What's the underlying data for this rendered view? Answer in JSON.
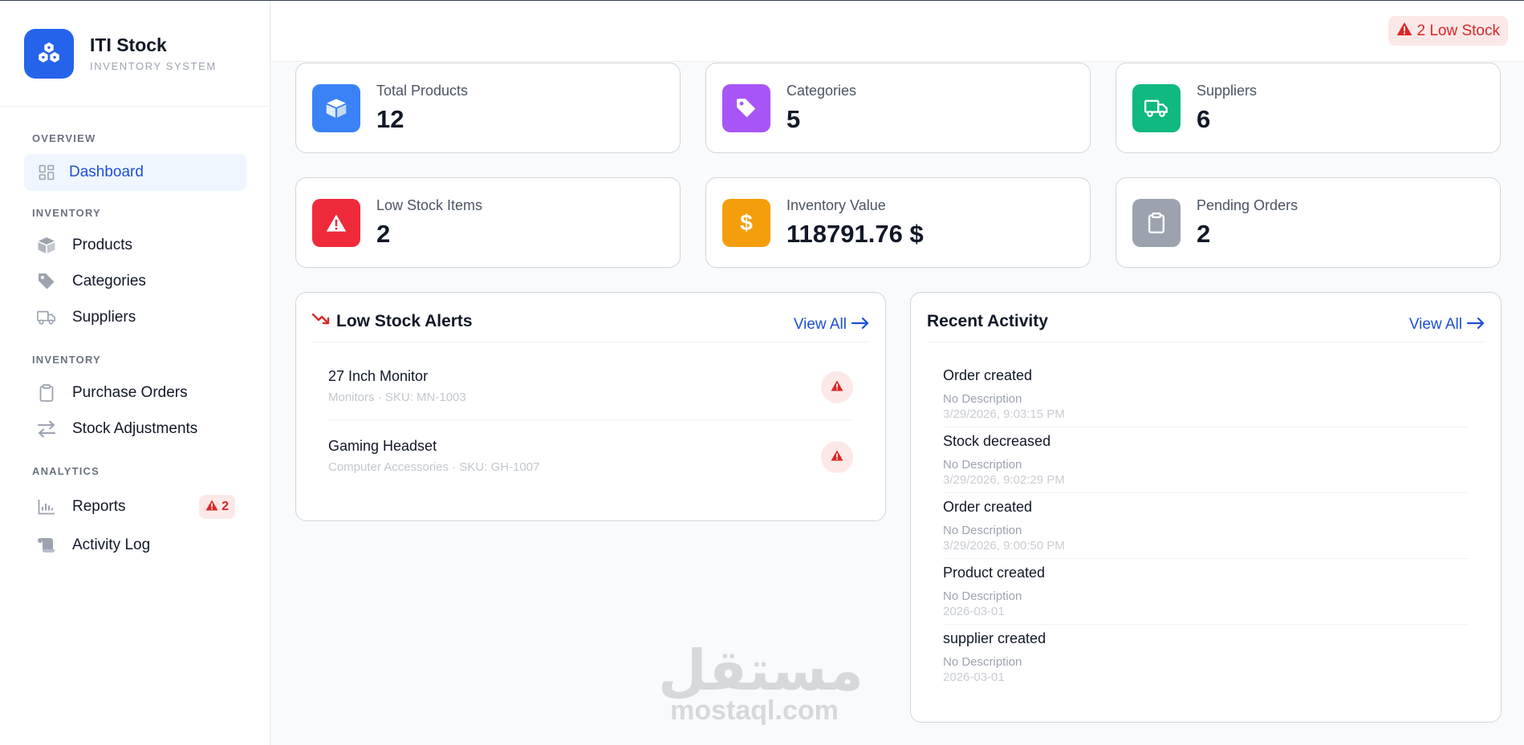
{
  "brand": {
    "title": "ITI Stock",
    "subtitle": "INVENTORY SYSTEM"
  },
  "sidebar": {
    "sections": [
      {
        "label": "OVERVIEW"
      },
      {
        "label": "INVENTORY"
      },
      {
        "label": "INVENTORY"
      },
      {
        "label": "ANALYTICS"
      }
    ],
    "items": [
      {
        "label": "Dashboard",
        "icon": "dashboard-grid-icon",
        "active": true
      },
      {
        "label": "Products",
        "icon": "box-icon"
      },
      {
        "label": "Categories",
        "icon": "tag-icon"
      },
      {
        "label": "Suppliers",
        "icon": "truck-icon"
      },
      {
        "label": "Purchase Orders",
        "icon": "clipboard-icon"
      },
      {
        "label": "Stock Adjustments",
        "icon": "arrows-exchange-icon"
      },
      {
        "label": "Reports",
        "icon": "chart-bars-icon",
        "badge": "2"
      },
      {
        "label": "Activity Log",
        "icon": "scroll-icon"
      }
    ]
  },
  "header": {
    "low_stock_badge": "2 Low Stock"
  },
  "stats": [
    {
      "label": "Total Products",
      "value": "12",
      "color": "#3b82f6",
      "icon": "box-icon"
    },
    {
      "label": "Categories",
      "value": "5",
      "color": "#a855f7",
      "icon": "tag-icon"
    },
    {
      "label": "Suppliers",
      "value": "6",
      "color": "#10b981",
      "icon": "truck-icon"
    },
    {
      "label": "Low Stock Items",
      "value": "2",
      "color": "#ef2b3b",
      "icon": "warning-icon"
    },
    {
      "label": "Inventory Value",
      "value": "118791.76 $",
      "color": "#f59e0b",
      "icon": "dollar-icon"
    },
    {
      "label": "Pending Orders",
      "value": "2",
      "color": "#9ca3af",
      "icon": "clipboard-icon"
    }
  ],
  "low_stock": {
    "title": "Low Stock Alerts",
    "view_all": "View All",
    "items": [
      {
        "name": "27 Inch Monitor",
        "meta": "Monitors · SKU: MN-1003"
      },
      {
        "name": "Gaming Headset",
        "meta": "Computer Accessories · SKU: GH-1007"
      }
    ]
  },
  "activity": {
    "title": "Recent Activity",
    "view_all": "View All",
    "items": [
      {
        "title": "Order created",
        "desc": "No Description",
        "time": "3/29/2026, 9:03:15 PM"
      },
      {
        "title": "Stock decreased",
        "desc": "No Description",
        "time": "3/29/2026, 9:02:29 PM"
      },
      {
        "title": "Order created",
        "desc": "No Description",
        "time": "3/29/2026, 9:00:50 PM"
      },
      {
        "title": "Product created",
        "desc": "No Description",
        "time": "2026-03-01"
      },
      {
        "title": "supplier created",
        "desc": "No Description",
        "time": "2026-03-01"
      }
    ]
  },
  "watermark": {
    "arabic": "مستقل",
    "latin": "mostaql.com"
  }
}
